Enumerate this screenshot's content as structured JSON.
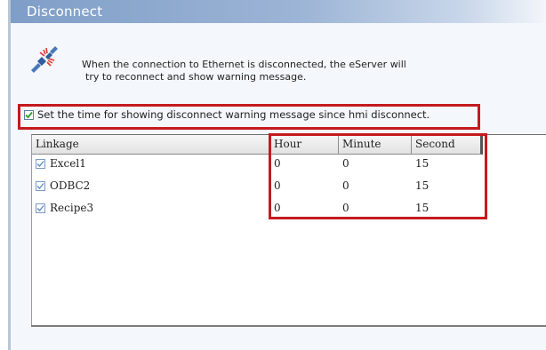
{
  "window": {
    "title": "Disconnect"
  },
  "info": {
    "icon": "network-disconnect-icon",
    "line1": "When the connection to Ethernet is disconnected, the eServer will",
    "line2": "try to reconnect and show warning message."
  },
  "option": {
    "checked": true,
    "label": "Set the time for showing disconnect warning message since hmi disconnect."
  },
  "table": {
    "headers": {
      "linkage": "Linkage",
      "hour": "Hour",
      "minute": "Minute",
      "second": "Second"
    },
    "rows": [
      {
        "checked": true,
        "linkage": "Excel1",
        "hour": "0",
        "minute": "0",
        "second": "15"
      },
      {
        "checked": true,
        "linkage": "ODBC2",
        "hour": "0",
        "minute": "0",
        "second": "15"
      },
      {
        "checked": true,
        "linkage": "Recipe3",
        "hour": "0",
        "minute": "0",
        "second": "15"
      }
    ]
  },
  "colors": {
    "highlight": "#c41a1e",
    "title_bar": "#7f9ec7"
  }
}
